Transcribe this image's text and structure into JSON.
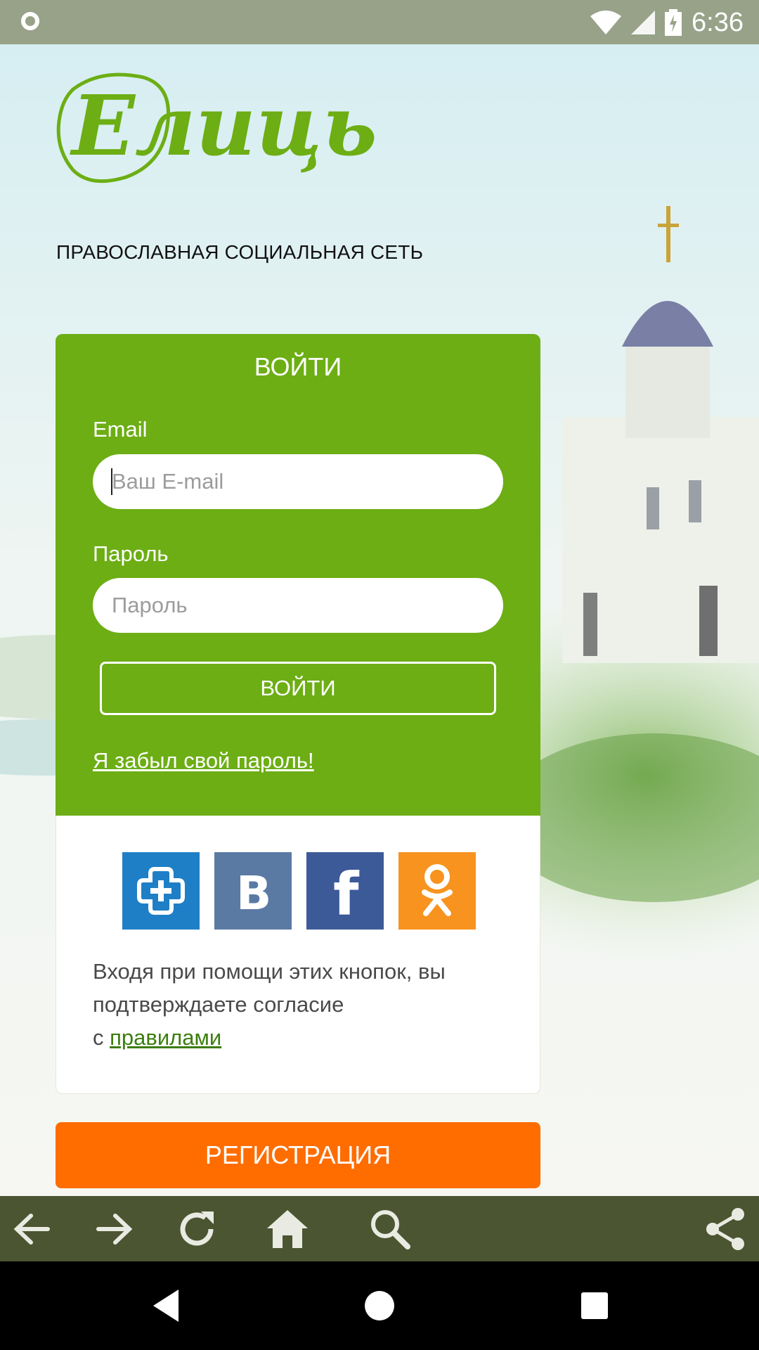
{
  "status_bar": {
    "time": "6:36"
  },
  "brand": {
    "logo_text": "Елицы",
    "tagline": "ПРАВОСЛАВНАЯ СОЦИАЛЬНАЯ СЕТЬ"
  },
  "login": {
    "title": "ВОЙТИ",
    "email_label": "Email",
    "email_placeholder": "Ваш E-mail",
    "email_value": "",
    "password_label": "Пароль",
    "password_placeholder": "Пароль",
    "password_value": "",
    "submit_label": "ВОЙТИ",
    "forgot_label": "Я забыл свой пароль!"
  },
  "social": {
    "providers": [
      "mail-plus-icon",
      "vk-icon",
      "facebook-icon",
      "odnoklassniki-icon"
    ],
    "colors": {
      "mail": "#1f7fc6",
      "vk": "#5a7aa4",
      "facebook": "#3c5a98",
      "ok": "#f7931e"
    },
    "disclaimer_prefix": "Входя при помощи этих кнопок, вы подтверждаете согласие",
    "disclaimer_c": "с",
    "rules_link": "правилами"
  },
  "register": {
    "label": "РЕГИСТРАЦИЯ"
  },
  "colors": {
    "green": "#6cae14",
    "orange": "#ff6d00",
    "toolbar": "#4b5531"
  },
  "browser_toolbar": {
    "icons": [
      "back-icon",
      "forward-icon",
      "reload-icon",
      "home-icon",
      "search-icon",
      "share-icon"
    ]
  },
  "nav_bar": {
    "icons": [
      "back-triangle-icon",
      "home-circle-icon",
      "recents-square-icon"
    ]
  }
}
